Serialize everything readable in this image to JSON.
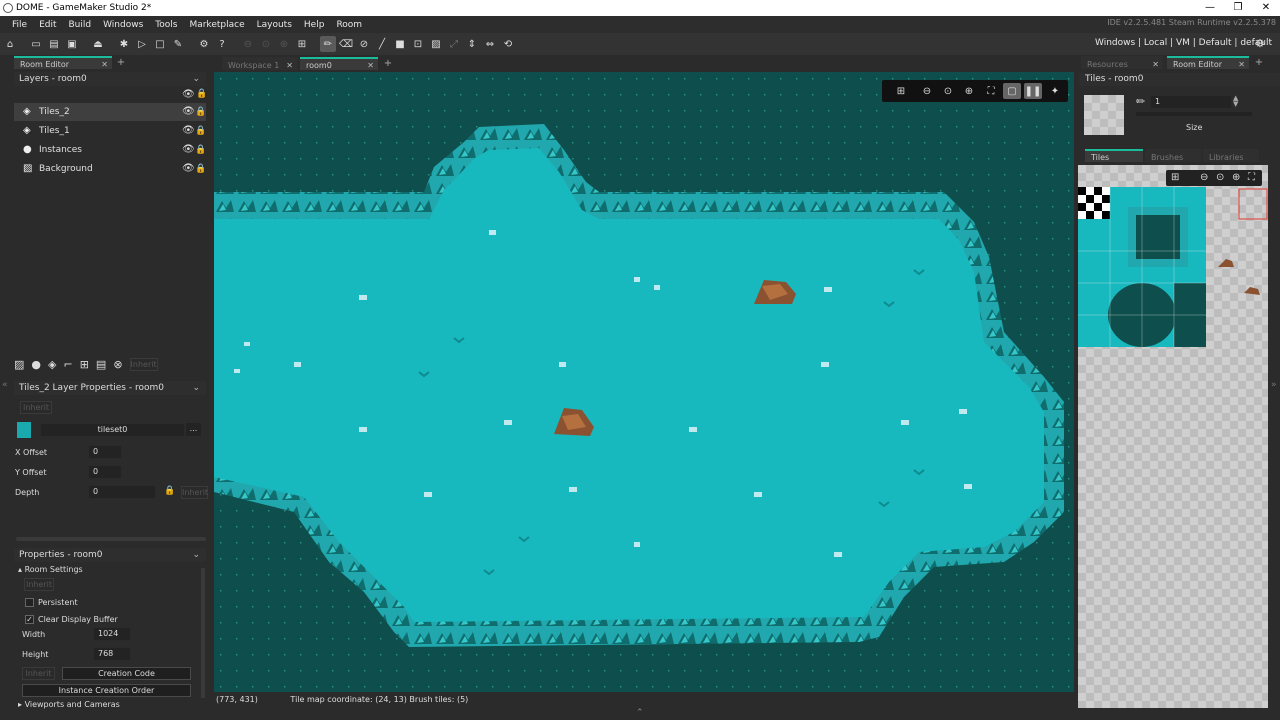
{
  "window": {
    "title": "DOME - GameMaker Studio 2*",
    "controls": [
      "—",
      "❐",
      "✕"
    ]
  },
  "menu": {
    "items": [
      "File",
      "Edit",
      "Build",
      "Windows",
      "Tools",
      "Marketplace",
      "Layouts",
      "Help",
      "Room"
    ],
    "version": "IDE v2.2.5.481 Steam  Runtime v2.2.5.378"
  },
  "toolbar": {
    "target": "Windows | Local | VM | Default | default"
  },
  "left": {
    "tab": "Room Editor",
    "layers_title": "Layers - room0",
    "layers": [
      "Tiles_2",
      "Tiles_1",
      "Instances",
      "Background"
    ],
    "inherit_btn": "Inherit",
    "layer_props_title": "Tiles_2 Layer Properties - room0",
    "tileset": "tileset0",
    "tileset_more": "...",
    "x_offset_label": "X Offset",
    "x_offset": "0",
    "y_offset_label": "Y Offset",
    "y_offset": "0",
    "depth_label": "Depth",
    "depth": "0",
    "props_title": "Properties - room0",
    "room_settings": "Room Settings",
    "persistent": "Persistent",
    "clear_display": "Clear Display Buffer",
    "width_label": "Width",
    "width": "1024",
    "height_label": "Height",
    "height": "768",
    "creation_code": "Creation Code",
    "instance_order": "Instance Creation Order",
    "viewports": "Viewports and Cameras"
  },
  "center": {
    "tabs": [
      "Workspace 1",
      "room0"
    ],
    "status_coords": "(773, 431)",
    "status_info": "Tile map coordinate: (24, 13) Brush tiles: (5)"
  },
  "right": {
    "tabs": [
      "Resources",
      "Room Editor"
    ],
    "title": "Tiles - room0",
    "brush_size_value": "1",
    "size_label": "Size",
    "subtabs": [
      "Tiles",
      "Brushes",
      "Libraries"
    ]
  },
  "colors": {
    "water": "#18b8bf",
    "ground": "#0e4f4d",
    "accent": "#1abc9c"
  }
}
